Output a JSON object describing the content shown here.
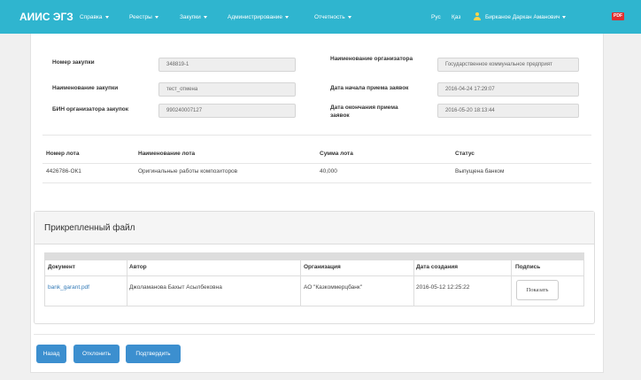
{
  "navbar": {
    "brand": "АИИС ЭГЗ",
    "menu": [
      {
        "label": "Справка"
      },
      {
        "label": "Реестры"
      },
      {
        "label": "Закупки"
      },
      {
        "label": "Администрирование"
      },
      {
        "label": "Отчетность"
      }
    ],
    "lang_ru": "Рус",
    "lang_kz": "Қаз",
    "user": "Бирканое Даркан Аманович",
    "pdf_badge": "PDF",
    "colors": {
      "bar": "#2fb5cf",
      "user_icon": "#ffd54a",
      "pdf_badge": "#e03030"
    }
  },
  "form": {
    "purchase_number_label": "Номер закупки",
    "purchase_number": "348819-1",
    "organizer_label": "Наименование организатора",
    "organizer": "Государственное коммунальное предприят",
    "purchase_name_label": "Наименование закупки",
    "purchase_name": "тест_отмена",
    "start_date_label": "Дата начала приема заявок",
    "start_date": "2016-04-24 17:29:07",
    "bin_label": "БИН организатора закупок",
    "bin": "990240007127",
    "end_date_label": "Дата окончания приема заявок",
    "end_date": "2016-05-20 18:13:44"
  },
  "lots": {
    "headers": [
      "Номер лота",
      "Наименование лота",
      "Сумма лота",
      "Статус"
    ],
    "rows": [
      [
        "4426786-ОК1",
        "Оригинальные работы композиторов",
        "40,000",
        "Выпущена банком"
      ]
    ]
  },
  "attached": {
    "title": "Прикрепленный файл",
    "headers": [
      "Документ",
      "Автор",
      "Организация",
      "Дата создания",
      "Подпись"
    ],
    "rows": [
      {
        "document": "bank_garant.pdf",
        "author": "Джоламанова Бахыт Асылбековна",
        "organization": "АО \"Казкоммерцбанк\"",
        "created": "2016-05-12 12:25:22",
        "action": "Показать"
      }
    ]
  },
  "actions": {
    "back": "Назад",
    "reject": "Отклонить",
    "confirm": "Подтвердить",
    "button_color": "#3c8fcf"
  }
}
